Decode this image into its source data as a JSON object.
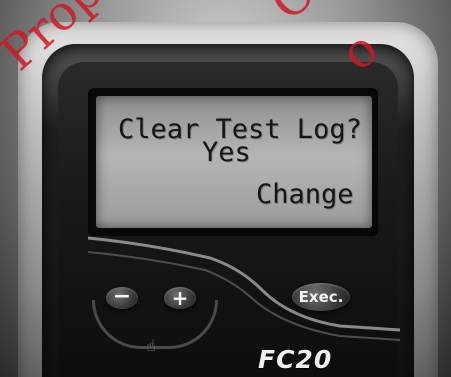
{
  "screen": {
    "line1": "Clear Test Log?",
    "line2": "Yes",
    "line3": "Change"
  },
  "buttons": {
    "minus": "−",
    "plus": "+",
    "exec": "Exec."
  },
  "brand": "FC20",
  "watermark": {
    "text1": "Property",
    "text2": "O",
    "text3": "o"
  },
  "colors": {
    "lcd_background": "#b0b0b0",
    "lcd_text": "#151515",
    "watermark": "#cd1923"
  }
}
